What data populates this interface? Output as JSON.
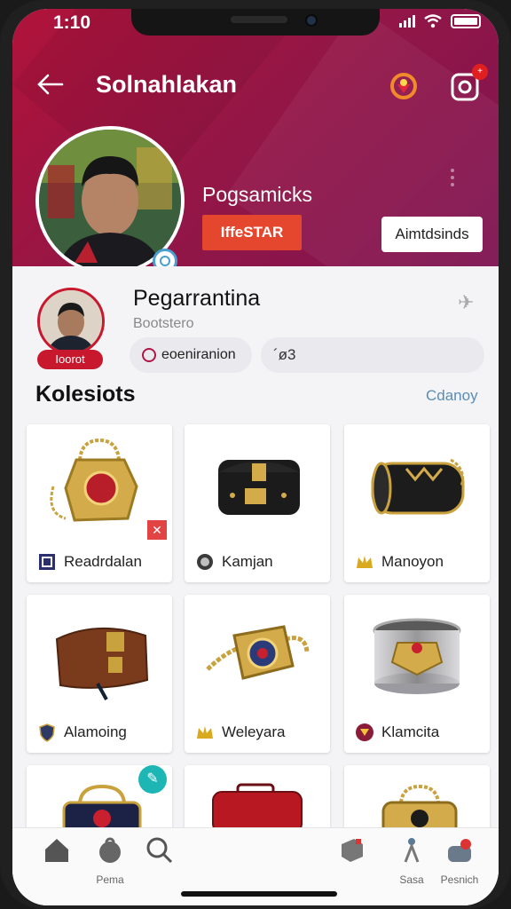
{
  "status_bar": {
    "time": "1:10"
  },
  "header": {
    "title": "Solnahlakan",
    "profile_name": "Pogsamicks",
    "primary_button": "IffeSTAR",
    "secondary_button": "Aimtdsinds"
  },
  "user": {
    "name": "Pegarrantina",
    "handle": "Bootstero",
    "avatar_tag": "Ioorot",
    "pill_action": "eoeniranion",
    "pill_value": "´ø3"
  },
  "collections": {
    "title": "Kolesiots",
    "link": "Cdanoy",
    "items": [
      {
        "label": "Readrdalan",
        "icon": "square-emblem-icon",
        "item_art": "gold-bag-icon"
      },
      {
        "label": "Kamjan",
        "icon": "round-badge-icon",
        "item_art": "black-bag-icon"
      },
      {
        "label": "Manoyon",
        "icon": "crown-icon",
        "item_art": "barrel-bag-icon"
      },
      {
        "label": "Alamoing",
        "icon": "shield-icon",
        "item_art": "brown-bag-icon"
      },
      {
        "label": "Weleyara",
        "icon": "crown-icon",
        "item_art": "gold-belt-icon"
      },
      {
        "label": "Klamcita",
        "icon": "circle-crest-icon",
        "item_art": "silver-cuff-icon"
      }
    ]
  },
  "bottom_nav": [
    {
      "label": "",
      "icon": "home-icon"
    },
    {
      "label": "Pema",
      "icon": "bag-icon"
    },
    {
      "label": "",
      "icon": "search-icon"
    },
    {
      "label": "",
      "icon": "box-icon"
    },
    {
      "label": "Sasa",
      "icon": "figure-icon"
    },
    {
      "label": "Pesnich",
      "icon": "profile-icon"
    }
  ],
  "colors": {
    "header_start": "#b0133a",
    "header_end": "#7e1452",
    "accent_red": "#e4462e",
    "link_blue": "#5a8db5"
  }
}
